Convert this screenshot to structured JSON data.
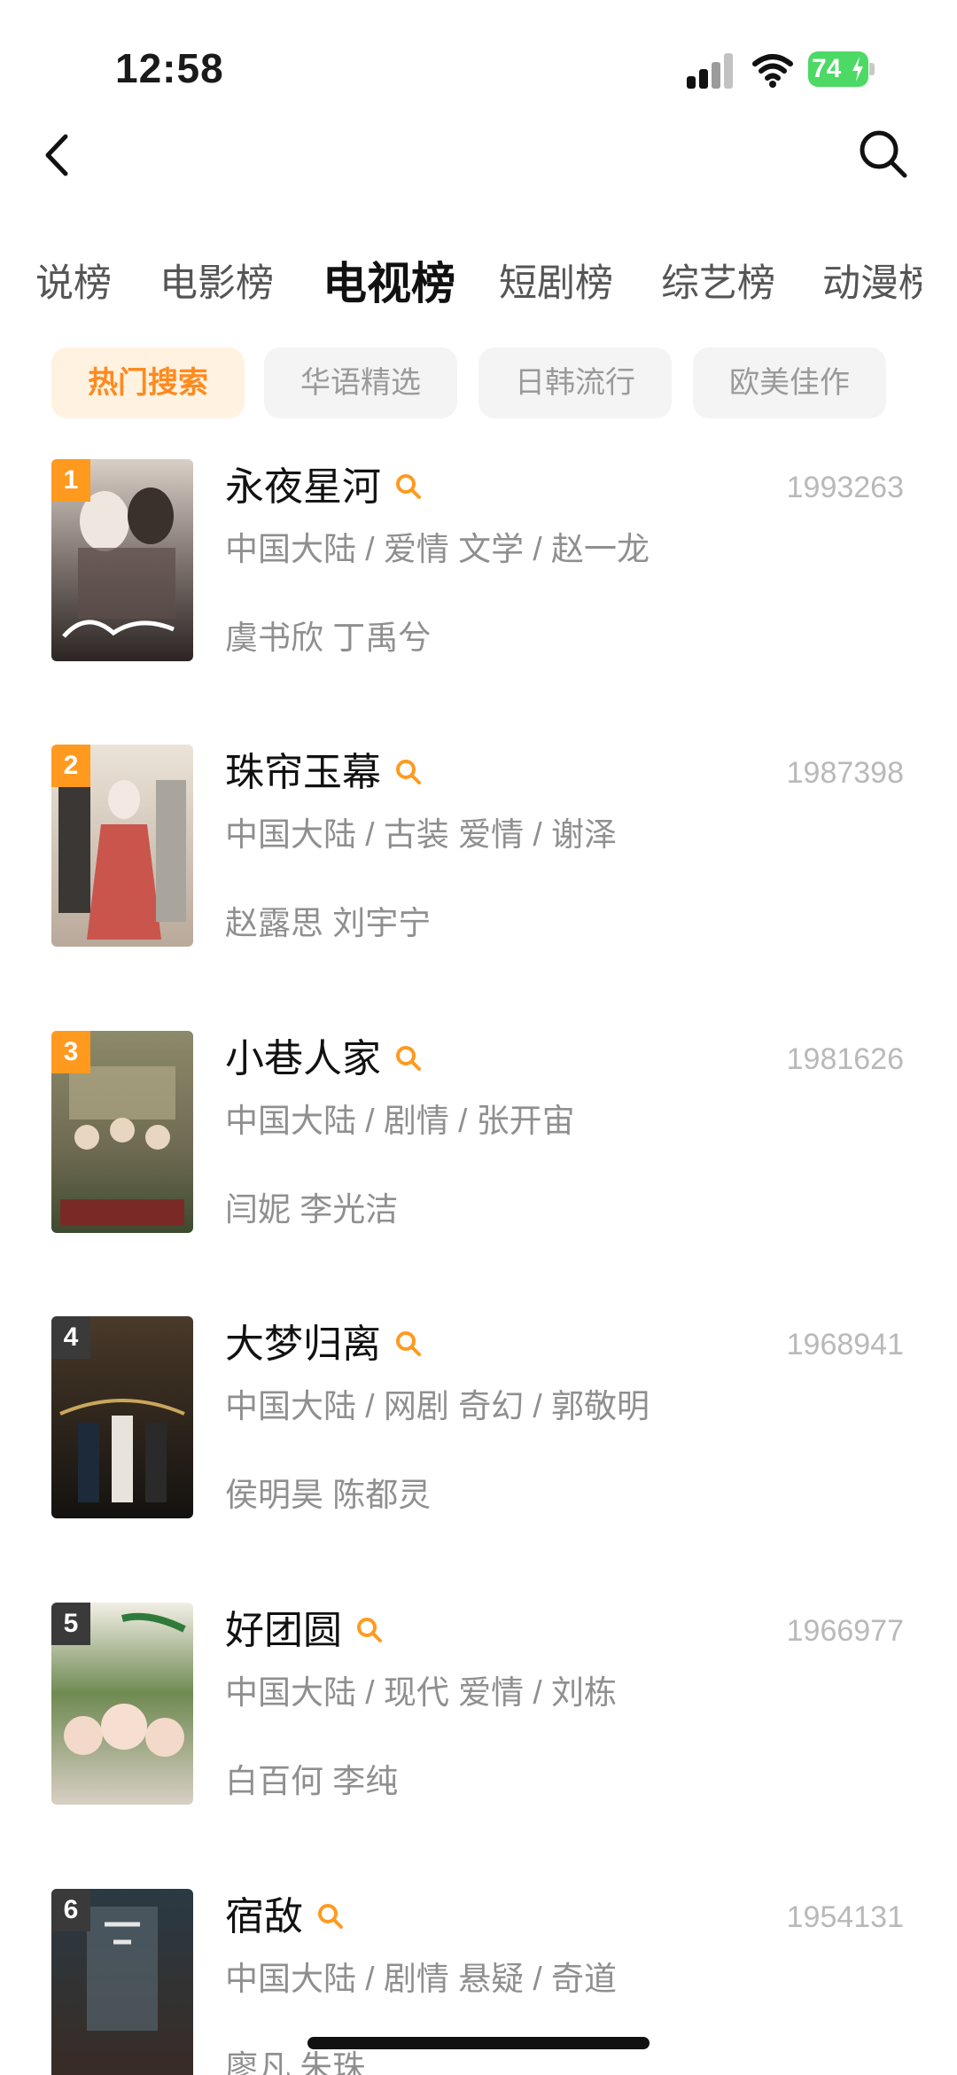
{
  "status_bar": {
    "time": "12:58",
    "battery": "74"
  },
  "nav": {
    "back_icon": "chevron-left-icon",
    "search_icon": "search-icon"
  },
  "tabs": [
    {
      "label": "说榜",
      "active": false
    },
    {
      "label": "电影榜",
      "active": false
    },
    {
      "label": "电视榜",
      "active": true
    },
    {
      "label": "短剧榜",
      "active": false
    },
    {
      "label": "综艺榜",
      "active": false
    },
    {
      "label": "动漫榜",
      "active": false
    }
  ],
  "chips": [
    {
      "label": "热门搜索",
      "active": true
    },
    {
      "label": "华语精选",
      "active": false
    },
    {
      "label": "日韩流行",
      "active": false
    },
    {
      "label": "欧美佳作",
      "active": false
    }
  ],
  "colors": {
    "accent": "#ff8a1f",
    "rank_top": "#ff9a1f",
    "rank_other": "#3a3a3a"
  },
  "list": [
    {
      "rank": "1",
      "title": "永夜星河",
      "score": "1993263",
      "meta": "中国大陆 / 爱情 文学 / 赵一龙",
      "cast": "虞书欣 丁禹兮",
      "poster_hint": "poster-1"
    },
    {
      "rank": "2",
      "title": "珠帘玉幕",
      "score": "1987398",
      "meta": "中国大陆 / 古装 爱情 / 谢泽",
      "cast": "赵露思 刘宇宁",
      "poster_hint": "poster-2"
    },
    {
      "rank": "3",
      "title": "小巷人家",
      "score": "1981626",
      "meta": "中国大陆 / 剧情 / 张开宙",
      "cast": "闫妮 李光洁",
      "poster_hint": "poster-3"
    },
    {
      "rank": "4",
      "title": "大梦归离",
      "score": "1968941",
      "meta": "中国大陆 / 网剧 奇幻 / 郭敬明",
      "cast": "侯明昊 陈都灵",
      "poster_hint": "poster-4"
    },
    {
      "rank": "5",
      "title": "好团圆",
      "score": "1966977",
      "meta": "中国大陆 / 现代 爱情 / 刘栋",
      "cast": "白百何 李纯",
      "poster_hint": "poster-5"
    },
    {
      "rank": "6",
      "title": "宿敌",
      "score": "1954131",
      "meta": "中国大陆 / 剧情 悬疑 / 奇道",
      "cast": "廖凡 朱珠",
      "poster_hint": "poster-6"
    }
  ]
}
